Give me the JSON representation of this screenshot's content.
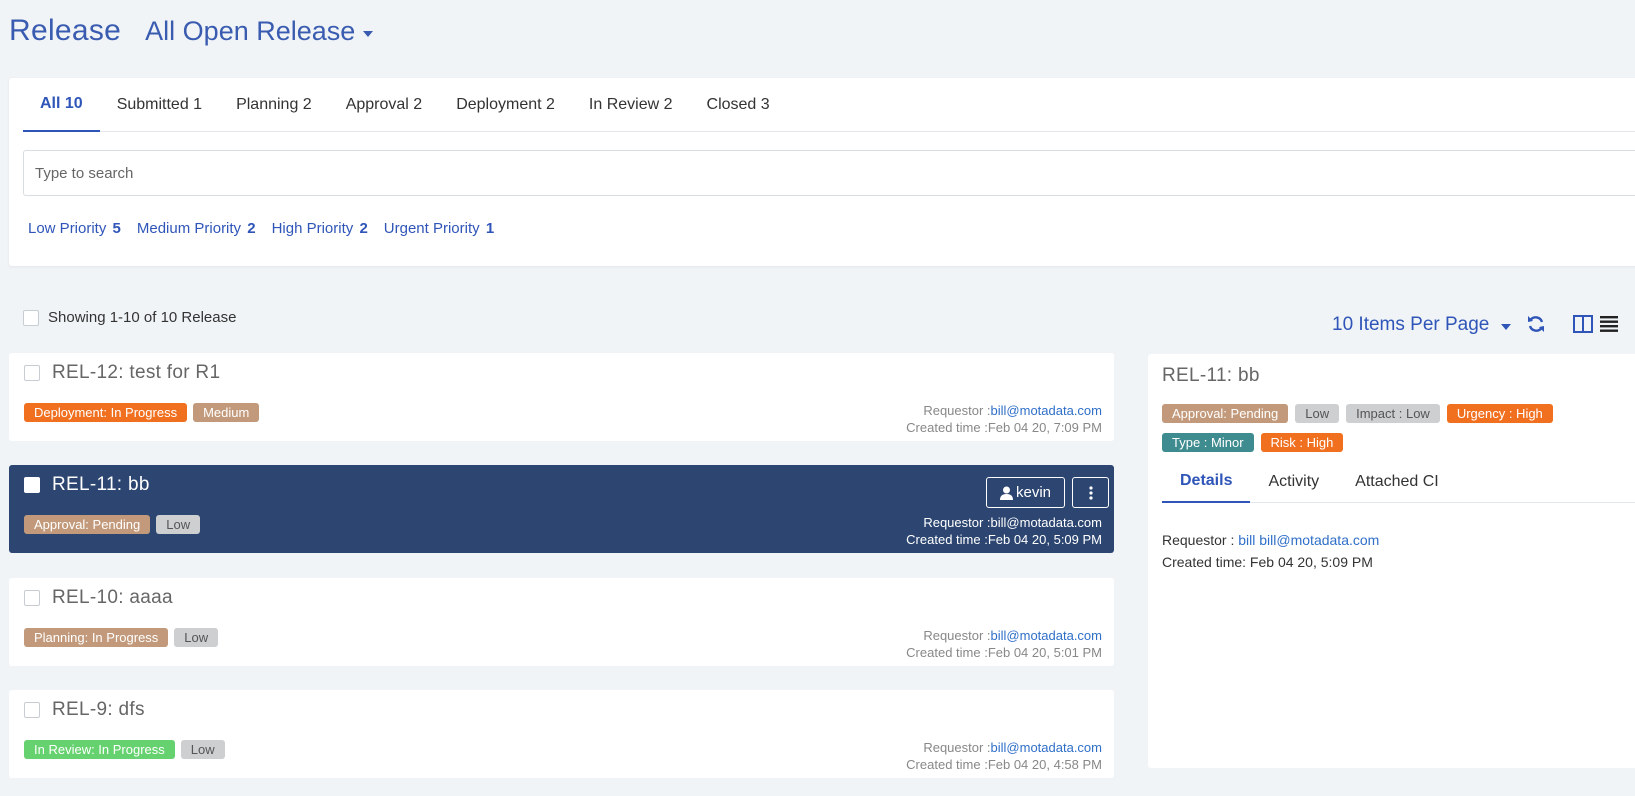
{
  "header": {
    "title": "Release",
    "view": "All Open Release"
  },
  "tabs": [
    {
      "label": "All 10"
    },
    {
      "label": "Submitted 1"
    },
    {
      "label": "Planning 2"
    },
    {
      "label": "Approval 2"
    },
    {
      "label": "Deployment 2"
    },
    {
      "label": "In Review 2"
    },
    {
      "label": "Closed 3"
    }
  ],
  "search": {
    "placeholder": "Type to search"
  },
  "priorities": [
    {
      "label": "Low Priority",
      "count": "5"
    },
    {
      "label": "Medium Priority",
      "count": "2"
    },
    {
      "label": "High Priority",
      "count": "2"
    },
    {
      "label": "Urgent Priority",
      "count": "1"
    }
  ],
  "list": {
    "showing": "Showing 1-10 of 10 Release",
    "per_page": "10 Items Per Page"
  },
  "cards": [
    {
      "title": "REL-12: test for R1",
      "badges": [
        "Deployment: In Progress",
        "Medium"
      ],
      "requestor_label": "Requestor :",
      "requestor": "bill@motadata.com",
      "created": "Created time :Feb 04 20, 7:09 PM"
    },
    {
      "title": "REL-11: bb",
      "badges": [
        "Approval: Pending",
        "Low"
      ],
      "assignee": "kevin",
      "requestor_label": "Requestor :",
      "requestor": "bill@motadata.com",
      "created": "Created time :Feb 04 20, 5:09 PM"
    },
    {
      "title": "REL-10: aaaa",
      "badges": [
        "Planning: In Progress",
        "Low"
      ],
      "requestor_label": "Requestor :",
      "requestor": "bill@motadata.com",
      "created": "Created time :Feb 04 20, 5:01 PM"
    },
    {
      "title": "REL-9: dfs",
      "badges": [
        "In Review: In Progress",
        "Low"
      ],
      "requestor_label": "Requestor :",
      "requestor": "bill@motadata.com",
      "created": "Created time :Feb 04 20, 4:58 PM"
    }
  ],
  "detail": {
    "title": "REL-11: bb",
    "badges_row1": [
      "Approval: Pending",
      "Low",
      "Impact : Low",
      "Urgency : High"
    ],
    "badges_row2": [
      "Type : Minor",
      "Risk : High"
    ],
    "tabs": [
      "Details",
      "Activity",
      "Attached CI"
    ],
    "requestor_label": "Requestor :",
    "requestor": "bill bill@motadata.com",
    "created": "Created time: Feb 04 20, 5:09 PM"
  },
  "colors": {
    "accent": "#2f55b8",
    "selected_card": "#2c4671",
    "orange": "#f07020",
    "brown": "#c29a7b",
    "green": "#66d16f",
    "teal": "#3f8c90"
  }
}
